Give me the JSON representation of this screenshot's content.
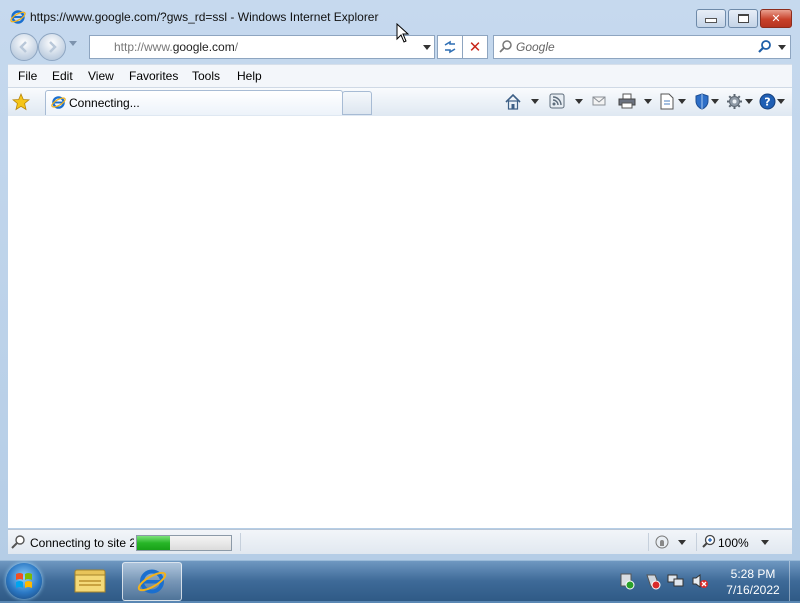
{
  "window": {
    "title": "https://www.google.com/?gws_rd=ssl - Windows Internet Explorer"
  },
  "address_bar": {
    "prefix": "http://www.",
    "domain": "google.com",
    "suffix": "/"
  },
  "search": {
    "placeholder": "Google"
  },
  "menu": {
    "items": [
      "File",
      "Edit",
      "View",
      "Favorites",
      "Tools",
      "Help"
    ]
  },
  "tab": {
    "label": "Connecting..."
  },
  "status": {
    "text": "Connecting to site 2",
    "progress": 0.35,
    "zoom": "100%"
  },
  "clock": {
    "time": "5:28 PM",
    "date": "7/16/2022"
  },
  "colors": {
    "accent": "#3e6a98",
    "stop_red": "#c8261a",
    "progress_green": "#27b527"
  },
  "icons": [
    "ie-icon",
    "back-icon",
    "forward-icon",
    "refresh-icon",
    "stop-icon",
    "search-icon",
    "favorites-star-icon",
    "home-icon",
    "rss-icon",
    "read-mail-icon",
    "print-icon",
    "page-icon",
    "safety-icon",
    "tools-gear-icon",
    "help-icon",
    "protected-mode-icon",
    "zoom-icon",
    "windows-orb-icon",
    "folder-icon",
    "network-icon",
    "volume-muted-icon"
  ]
}
